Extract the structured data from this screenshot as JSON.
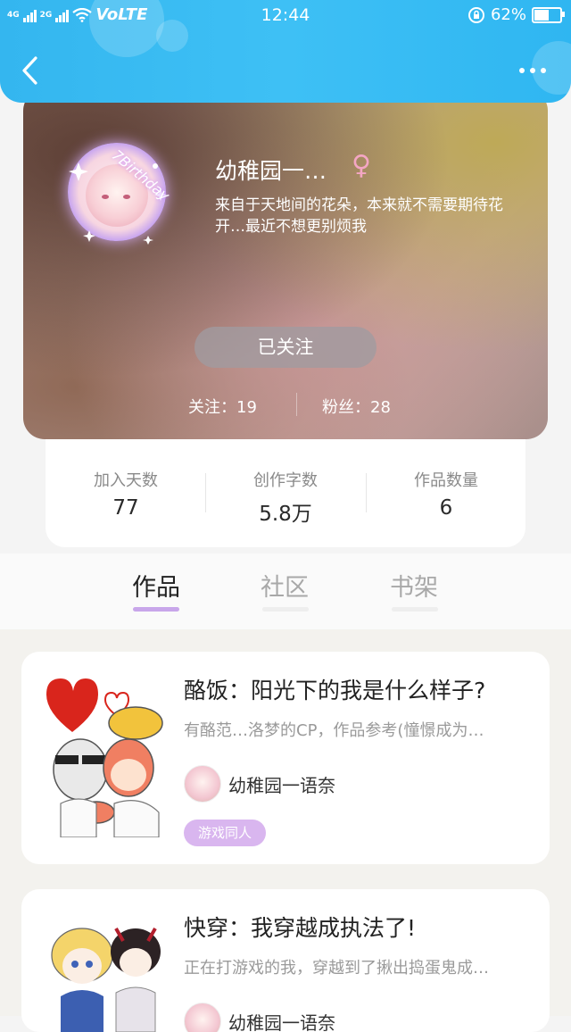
{
  "status_bar": {
    "network_left": "4G",
    "network_right": "2G",
    "carrier_tag": "VoLTE",
    "time": "12:44",
    "battery": "62%",
    "battery_level": 0.62
  },
  "header": {
    "back_icon": "chevron-left-icon",
    "more_icon": "more-dots-icon"
  },
  "profile": {
    "avatar_frame_text": "7Birthday",
    "nickname": "幼稚园一…",
    "gender_symbol": "♀",
    "bio": "来自于天地间的花朵，本来就不需要期待花开…最近不想更别烦我",
    "follow_button": "已关注",
    "following": "关注：19",
    "fans": "粉丝：28"
  },
  "stats": [
    {
      "label": "加入天数",
      "value": "77"
    },
    {
      "label": "创作字数",
      "value": "5.8万"
    },
    {
      "label": "作品数量",
      "value": "6"
    }
  ],
  "tabs": [
    {
      "label": "作品",
      "active": true
    },
    {
      "label": "社区",
      "active": false
    },
    {
      "label": "书架",
      "active": false
    }
  ],
  "works": [
    {
      "title": "酪饭：阳光下的我是什么样子?",
      "desc": "有酪范…洛梦的CP，作品参考(憧憬成为…",
      "author": "幼稚园一语奈",
      "tag": "游戏同人"
    },
    {
      "title": "快穿：我穿越成执法了!",
      "desc": "正在打游戏的我，穿越到了揪出捣蛋鬼成…",
      "author": "幼稚园一语奈",
      "tag": ""
    }
  ],
  "colors": {
    "header": "#3ebdf3",
    "tab_indicator": "#c8a6ea",
    "tag": "#d9b6ef"
  }
}
